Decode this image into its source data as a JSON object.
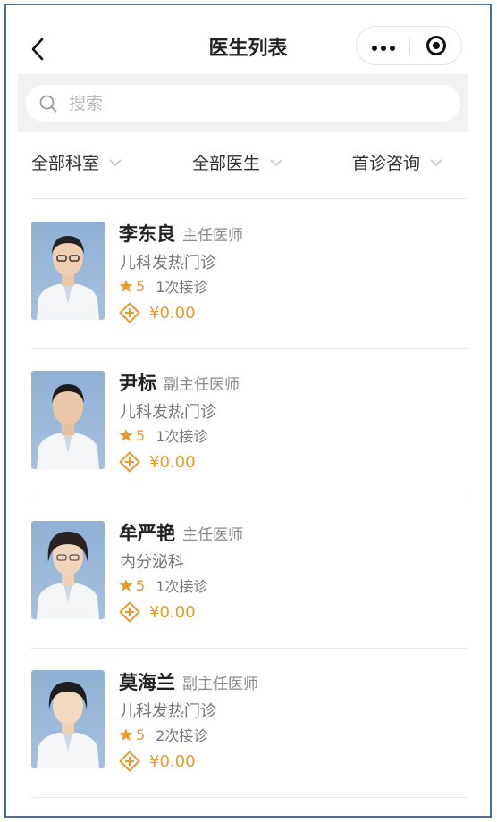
{
  "header": {
    "title": "医生列表"
  },
  "search": {
    "placeholder": "搜索"
  },
  "filters": [
    {
      "label": "全部科室"
    },
    {
      "label": "全部医生"
    },
    {
      "label": "首诊咨询"
    }
  ],
  "doctors": [
    {
      "name": "李东良",
      "rank": "主任医师",
      "dept": "儿科发热门诊",
      "rating": "5",
      "visits": "1次接诊",
      "price": "¥0.00"
    },
    {
      "name": "尹标",
      "rank": "副主任医师",
      "dept": "儿科发热门诊",
      "rating": "5",
      "visits": "1次接诊",
      "price": "¥0.00"
    },
    {
      "name": "牟严艳",
      "rank": "主任医师",
      "dept": "内分泌科",
      "rating": "5",
      "visits": "1次接诊",
      "price": "¥0.00"
    },
    {
      "name": "莫海兰",
      "rank": "副主任医师",
      "dept": "儿科发热门诊",
      "rating": "5",
      "visits": "2次接诊",
      "price": "¥0.00"
    }
  ],
  "colors": {
    "accent": "#e89a2b",
    "frame": "#4a6f9a"
  },
  "icons": [
    "back-arrow-icon",
    "more-dots-icon",
    "close-ring-icon",
    "search-icon",
    "chevron-down-icon",
    "star-icon",
    "price-tag-icon"
  ]
}
